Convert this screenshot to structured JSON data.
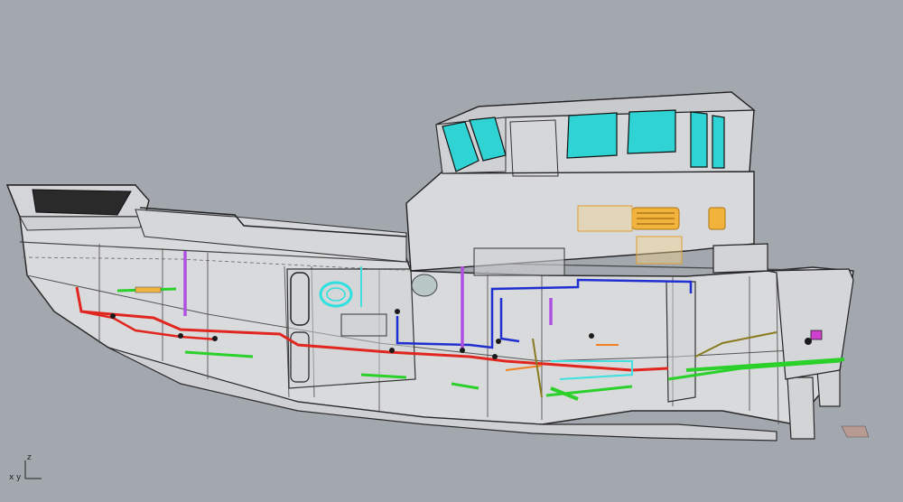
{
  "viewport": {
    "background_color": "#a3a8af",
    "hull_color": "#d9dadc",
    "outline_color": "#2a2a2a",
    "glass_color": "#2fd3d3",
    "vent_color": "#f2b33d"
  },
  "axis_widget": {
    "x_label": "x",
    "y_label": "y",
    "z_label": "z"
  },
  "piping": {
    "fuel_color": "#e0261e",
    "freshwater_color": "#2030d0",
    "seawater_color": "#2bd02b",
    "vent_line_color": "#b050e0",
    "oil_color": "#f08020",
    "cooling_color": "#40e0e0",
    "exhaust_color": "#8a7a20"
  }
}
